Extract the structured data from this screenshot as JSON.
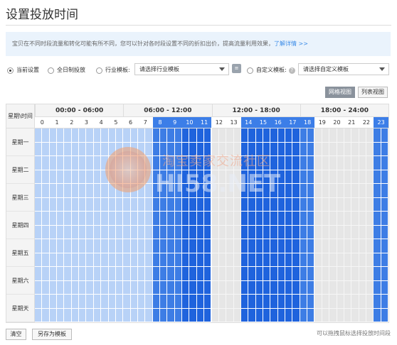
{
  "page": {
    "title": "设置投放时间"
  },
  "info": {
    "text": "宝贝在不同时段流量和转化可能有所不同，您可以针对各时段设置不同的折扣出价，提高流量利用效果，",
    "link": "了解详情 >>"
  },
  "options": {
    "current": "当前设置",
    "allday": "全日制投放",
    "industry": "行业模板:",
    "industry_select": "请选择行业模板",
    "custom": "自定义模板:",
    "custom_select": "请选择自定义模板",
    "selected": "current"
  },
  "views": {
    "grid": "网格视图",
    "list": "列表视图"
  },
  "schedule": {
    "corner": "星期\\时间",
    "ranges": [
      "00:00 - 06:00",
      "06:00 - 12:00",
      "12:00 - 18:00",
      "18:00 - 24:00"
    ],
    "hours": [
      "0",
      "1",
      "2",
      "3",
      "4",
      "5",
      "6",
      "7",
      "8",
      "9",
      "10",
      "11",
      "12",
      "13",
      "14",
      "15",
      "16",
      "17",
      "18",
      "19",
      "20",
      "21",
      "22",
      "23"
    ],
    "highlighted_hours": [
      "8",
      "9",
      "10",
      "11",
      "14",
      "15",
      "16",
      "17",
      "18",
      "23"
    ],
    "days": [
      "星期一",
      "星期二",
      "星期三",
      "星期四",
      "星期五",
      "星期六",
      "星期天"
    ],
    "hour_levels": [
      "light",
      "light",
      "light",
      "light",
      "light",
      "light",
      "light",
      "light",
      "mid",
      "mid",
      "dark",
      "dark",
      "none",
      "none",
      "dark",
      "dark",
      "dark",
      "dark",
      "mid",
      "none",
      "none",
      "none",
      "none",
      "mid"
    ],
    "colors": {
      "light": "#b8d2f7",
      "mid": "#3d7de5",
      "dark": "#1f63dd",
      "none": "#e6e6e6"
    }
  },
  "watermark": {
    "cn": "淘宝卖家交流社区",
    "en": "HI58.NET"
  },
  "footer": {
    "clear": "清空",
    "save_template": "另存为模板",
    "hint": "可以拖拽鼠标选择投放时间段"
  }
}
